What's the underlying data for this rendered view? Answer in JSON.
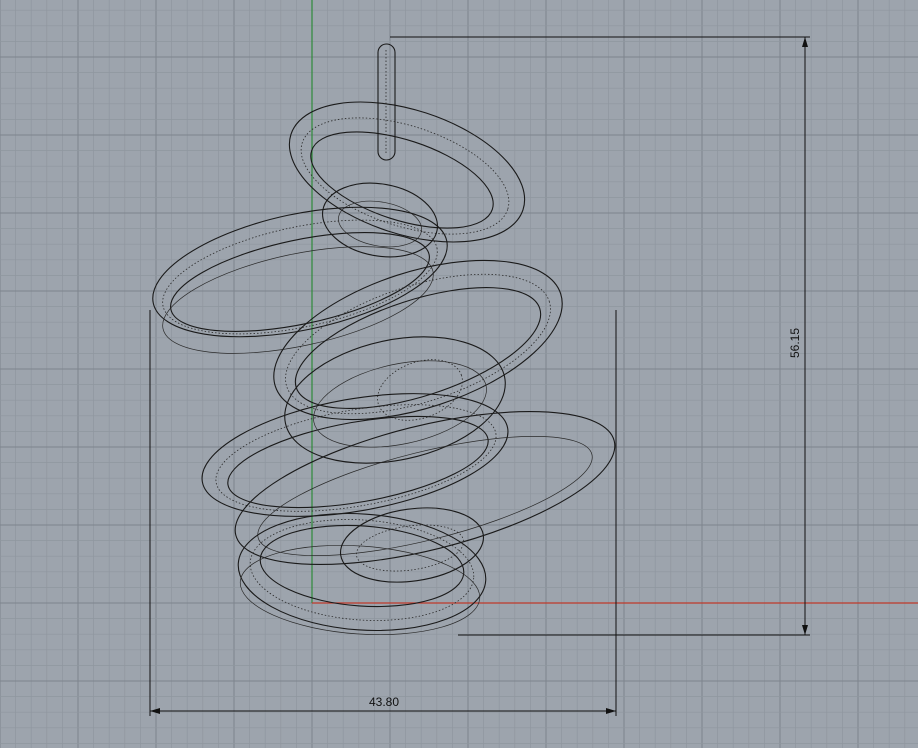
{
  "viewport": {
    "background": "#9da4ad",
    "grid_minor_color": "#8f969f",
    "grid_major_color": "#7d848d",
    "axis_x_color": "#c0392b",
    "axis_y_color": "#2e8b3a"
  },
  "dimensions": {
    "width_label": "43.80",
    "height_label": "56.15"
  }
}
